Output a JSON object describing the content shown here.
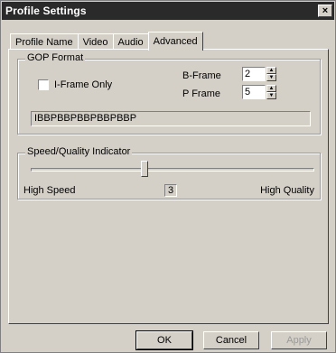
{
  "window": {
    "title": "Profile Settings",
    "close_glyph": "×"
  },
  "tabs": [
    {
      "label": "Profile Name",
      "active": false
    },
    {
      "label": "Video",
      "active": false
    },
    {
      "label": "Audio",
      "active": false
    },
    {
      "label": "Advanced",
      "active": true
    }
  ],
  "gop": {
    "legend": "GOP Format",
    "iframe_only_label": "I-Frame Only",
    "iframe_only_checked": false,
    "bframe_label": "B-Frame",
    "bframe_value": "2",
    "pframe_label": "P Frame",
    "pframe_value": "5",
    "pattern": "IBBPBBPBBPBBPBBP"
  },
  "speed": {
    "legend": "Speed/Quality Indicator",
    "low_label": "High Speed",
    "high_label": "High Quality",
    "value": "3",
    "min": 1,
    "max": 6
  },
  "buttons": {
    "ok": "OK",
    "cancel": "Cancel",
    "apply": "Apply"
  },
  "icons": {
    "close": "close-icon",
    "spin_up": "spin-up-icon",
    "spin_down": "spin-down-icon"
  }
}
